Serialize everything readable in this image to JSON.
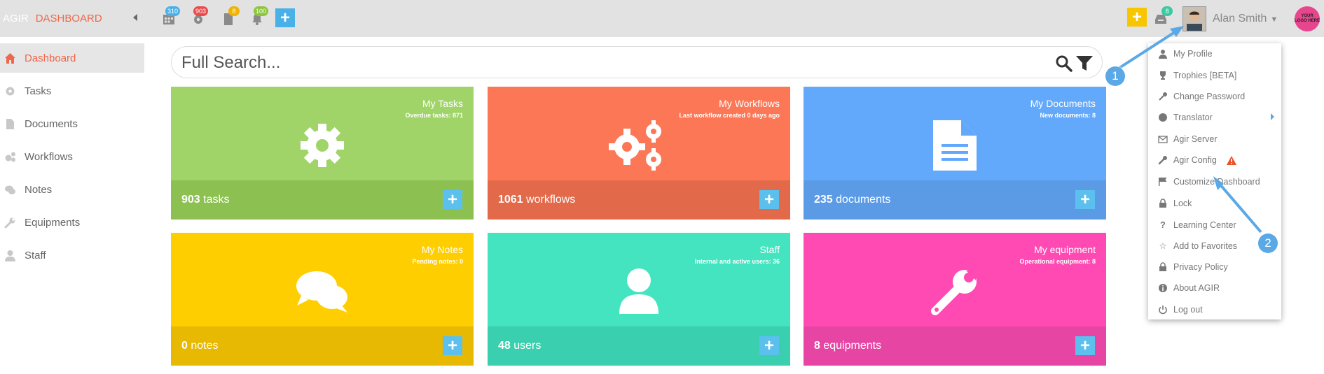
{
  "brand": {
    "app": "AGIR",
    "section": "DASHBOARD"
  },
  "topbar": {
    "badges": {
      "calendar": "310",
      "tasks": "903",
      "documents": "8",
      "notifications": "100",
      "inbox": "8"
    },
    "user_name": "Alan Smith",
    "logo_text": "YOUR LOGO HERE",
    "colors": {
      "calendar_badge": "#4ab0e8",
      "tasks_badge": "#e84c4c",
      "documents_badge": "#f0b400",
      "notifications_badge": "#8cc63f",
      "add_button": "#4ab0e8",
      "quick_add": "#f7c600",
      "inbox_badge": "#3cc8a0"
    }
  },
  "sidebar": {
    "items": [
      {
        "label": "Dashboard",
        "icon": "home-icon"
      },
      {
        "label": "Tasks",
        "icon": "gear-icon"
      },
      {
        "label": "Documents",
        "icon": "document-icon"
      },
      {
        "label": "Workflows",
        "icon": "gears-icon"
      },
      {
        "label": "Notes",
        "icon": "comments-icon"
      },
      {
        "label": "Equipments",
        "icon": "wrench-icon"
      },
      {
        "label": "Staff",
        "icon": "user-icon"
      }
    ]
  },
  "search": {
    "placeholder": "Full Search..."
  },
  "tiles": [
    {
      "title": "My Tasks",
      "subtitle": "Overdue tasks: 871",
      "count": "903",
      "unit": "tasks",
      "color": "#a0d468",
      "foot": "#8cc152",
      "icon": "gear-icon"
    },
    {
      "title": "My Workflows",
      "subtitle": "Last workflow created 0 days ago",
      "count": "1061",
      "unit": "workflows",
      "color": "#fc7756",
      "foot": "#e2694a",
      "icon": "gears-icon"
    },
    {
      "title": "My Documents",
      "subtitle": "New documents: 8",
      "count": "235",
      "unit": "documents",
      "color": "#62a8fb",
      "foot": "#5b9be6",
      "icon": "document-icon"
    },
    {
      "title": "My Notes",
      "subtitle": "Pending notes: 0",
      "count": "0",
      "unit": "notes",
      "color": "#ffce00",
      "foot": "#e7b902",
      "icon": "comments-icon"
    },
    {
      "title": "Staff",
      "subtitle": "Internal and active users: 36",
      "count": "48",
      "unit": "users",
      "color": "#43e4bf",
      "foot": "#3acfae",
      "icon": "user-icon"
    },
    {
      "title": "My equipment",
      "subtitle": "Operational equipment: 8",
      "count": "8",
      "unit": "equipments",
      "color": "#ff4ab3",
      "foot": "#e745a4",
      "icon": "wrench-icon"
    }
  ],
  "user_menu": {
    "items": [
      {
        "label": "My Profile",
        "icon": "user-icon"
      },
      {
        "label": "Trophies [BETA]",
        "icon": "trophy-icon"
      },
      {
        "label": "Change Password",
        "icon": "key-icon"
      },
      {
        "label": "Translator",
        "icon": "globe-icon"
      },
      {
        "label": "Agir Server",
        "icon": "envelope-icon"
      },
      {
        "label": "Agir Config",
        "icon": "wrench-icon"
      },
      {
        "label": "Customize Dashboard",
        "icon": "flag-icon"
      },
      {
        "label": "Lock",
        "icon": "lock-icon"
      },
      {
        "label": "Learning Center",
        "icon": "question-icon"
      },
      {
        "label": "Add to Favorites",
        "icon": "star-icon"
      },
      {
        "label": "Privacy Policy",
        "icon": "lock-icon"
      },
      {
        "label": "About AGIR",
        "icon": "info-icon"
      },
      {
        "label": "Log out",
        "icon": "power-icon"
      }
    ]
  },
  "callouts": [
    "1",
    "2"
  ]
}
